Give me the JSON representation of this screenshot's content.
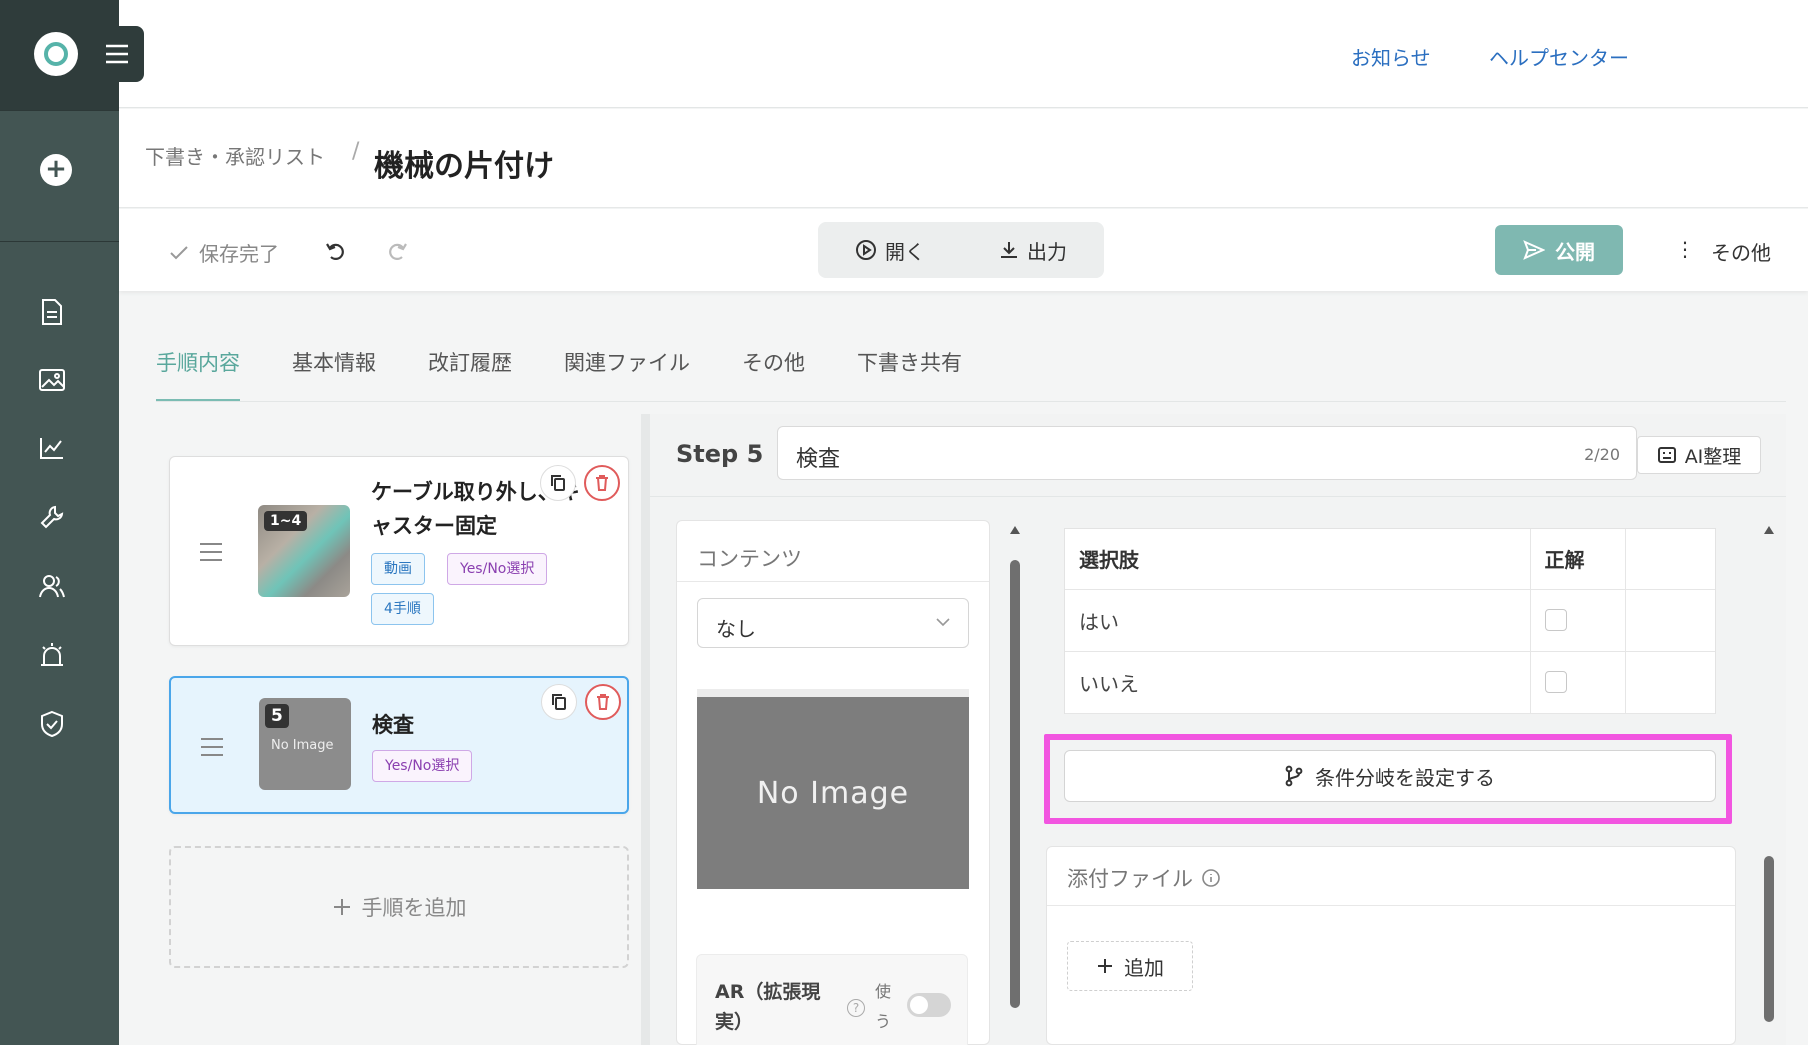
{
  "header": {
    "links": [
      {
        "label": "お知らせ"
      },
      {
        "label": "ヘルプセンター"
      }
    ]
  },
  "breadcrumb": {
    "parent": "下書き・承認リスト",
    "separator": "/",
    "title": "機械の片付け"
  },
  "toolbar": {
    "saved": "保存完了",
    "open": "開く",
    "output": "出力",
    "publish": "公開",
    "more": "その他",
    "more_glyph": "⋮"
  },
  "tabs": [
    {
      "label": "手順内容",
      "active": true
    },
    {
      "label": "基本情報"
    },
    {
      "label": "改訂履歴"
    },
    {
      "label": "関連ファイル"
    },
    {
      "label": "その他"
    },
    {
      "label": "下書き共有"
    }
  ],
  "steps": [
    {
      "badge": "1~4",
      "title_line1": "ケーブル取り外し、キ",
      "title_line2": "ャスター固定",
      "tags": [
        "動画",
        "Yes/No選択",
        "4手順"
      ]
    },
    {
      "badge": "5",
      "no_image": "No Image",
      "title": "検査",
      "tags": [
        "Yes/No選択"
      ]
    }
  ],
  "add_step": "手順を追加",
  "detail": {
    "step_label": "Step 5",
    "step_value": "検査",
    "char_count": "2/20",
    "ai_button": "AI整理",
    "contents_title": "コンテンツ",
    "contents_select": "なし",
    "no_image": "No Image",
    "ar_label": "AR（拡張現実）",
    "ar_use": "使う",
    "choices_header": [
      "選択肢",
      "正解"
    ],
    "choices": [
      {
        "label": "はい",
        "correct": false
      },
      {
        "label": "いいえ",
        "correct": false
      }
    ],
    "branch_button": "条件分岐を設定する",
    "attach_title": "添付ファイル",
    "attach_add": "追加"
  },
  "colors": {
    "rail": "#435553",
    "accent": "#7bbcb3",
    "publish": "#7fb8b1",
    "link": "#2b6fc0",
    "highlight": "#f255e0",
    "active_step_border": "#4aa6ea"
  }
}
